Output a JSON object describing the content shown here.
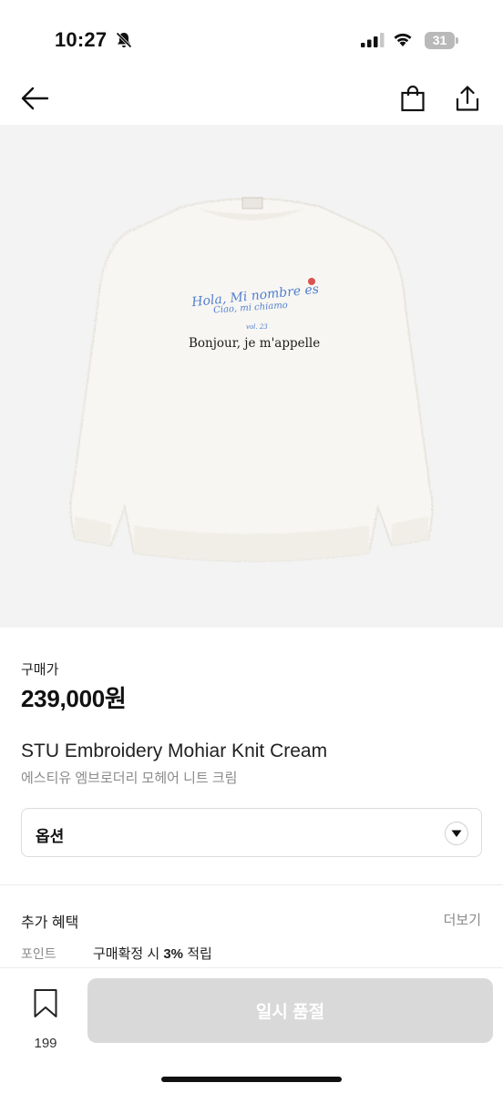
{
  "status_bar": {
    "time": "10:27",
    "battery": "31",
    "icons": [
      "bell-off-icon",
      "signal-icon",
      "wifi-icon",
      "battery-icon"
    ]
  },
  "nav": {
    "icons": [
      "back-arrow-icon",
      "shopping-bag-icon",
      "share-icon"
    ]
  },
  "product_image": {
    "print_lines": [
      "Hola, Mi nombre es",
      "Ciao, mi chiamo",
      "vol. 23",
      "Bonjour, je m'appelle"
    ]
  },
  "product": {
    "price_label": "구매가",
    "price": "239,000원",
    "name_en": "STU Embroidery Mohiar Knit Cream",
    "name_ko": "에스티유 엠브로더리 모헤어 니트 크림"
  },
  "option": {
    "label": "옵션",
    "icon": "chevron-down-icon"
  },
  "benefits": {
    "title": "추가 혜택",
    "more": "더보기",
    "point_label": "포인트",
    "point_prefix": "구매확정 시 ",
    "point_value": "3%",
    "point_suffix": " 적립"
  },
  "bottom_bar": {
    "wish_count": "199",
    "buy_label": "일시 품절"
  },
  "colors": {
    "image_bg": "#f3f3f3",
    "sweater": "#f8f6f2",
    "embroidery_blue": "#4f7fd0",
    "disabled_button": "#d9d9d9"
  }
}
